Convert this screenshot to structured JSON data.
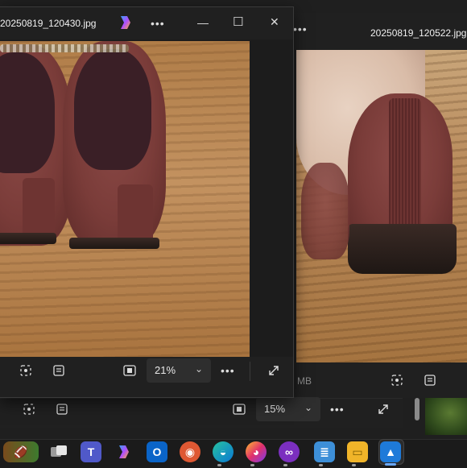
{
  "background_window": {
    "title": "20250819_120522.jpg",
    "size_partial": "MB",
    "zoom_value": "15%",
    "more_label": "•••"
  },
  "foreground_window": {
    "title": "20250819_120430.jpg",
    "zoom_value": "21%",
    "more_label": "•••",
    "minimize_label": "—",
    "maximize_label": "☐",
    "close_label": "✕",
    "copilot_icon": "copilot-icon"
  },
  "taskbar": {
    "items": [
      {
        "name": "football-widget",
        "glyph": "🏈"
      },
      {
        "name": "task-view",
        "glyph": "▣"
      },
      {
        "name": "teams",
        "glyph": "T"
      },
      {
        "name": "copilot",
        "glyph": "◆"
      },
      {
        "name": "outlook",
        "glyph": "O"
      },
      {
        "name": "duckduckgo",
        "glyph": "◉"
      },
      {
        "name": "edge",
        "glyph": "◒"
      },
      {
        "name": "firefox",
        "glyph": "◕"
      },
      {
        "name": "private-browser",
        "glyph": "∞"
      },
      {
        "name": "notepad",
        "glyph": "≣"
      },
      {
        "name": "file-explorer",
        "glyph": "▭"
      },
      {
        "name": "photos",
        "glyph": "▲"
      }
    ]
  },
  "colors": {
    "accent": "#6aa9ff",
    "titlebar": "#202020",
    "window_bg": "#1c1c1c"
  }
}
